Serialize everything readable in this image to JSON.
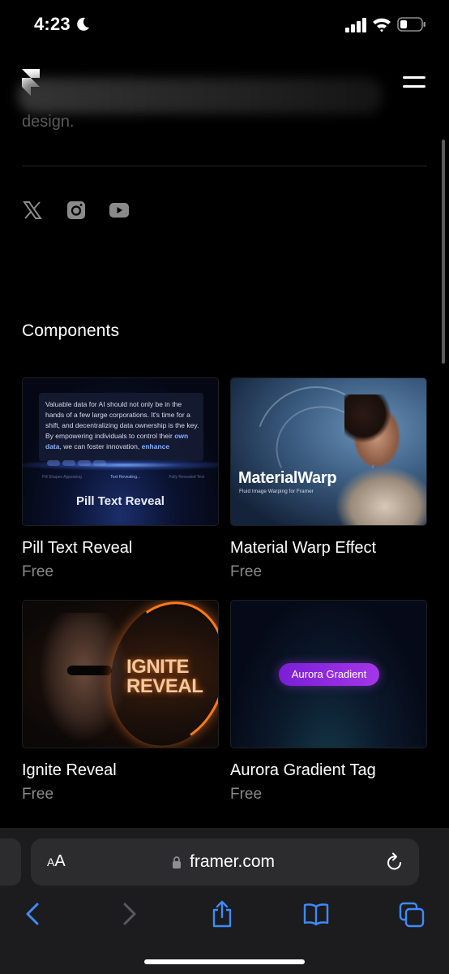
{
  "status_bar": {
    "time": "4:23"
  },
  "site": {
    "footer_tagline_end": "design."
  },
  "social": [
    "x-icon",
    "instagram-icon",
    "youtube-icon"
  ],
  "components": {
    "section_title": "Components",
    "cards": [
      {
        "title": "Pill Text Reveal",
        "price": "Free",
        "thumb": {
          "paragraph_start": "Valuable data for AI should not only be in the hands of a few large corporations. It's time for a shift, and decentralizing data ownership is the key. By empowering individuals to control their ",
          "highlight_1": "own data",
          "paragraph_mid": ", we can foster innovation, ",
          "highlight_2": "enhance",
          "step_1": "Pill Shapes Appearing",
          "step_2": "Text Revealing...",
          "step_3": "Fully Revealed Text",
          "caption": "Pill Text Reveal"
        }
      },
      {
        "title": "Material Warp Effect",
        "price": "Free",
        "thumb": {
          "caption": "MaterialWarp",
          "subcaption": "Fluid Image Warping for Framer"
        }
      },
      {
        "title": "Ignite Reveal",
        "price": "Free",
        "thumb": {
          "line1": "IGNITE",
          "line2": "REVEAL"
        }
      },
      {
        "title": "Aurora Gradient Tag",
        "price": "Free",
        "thumb": {
          "tag": "Aurora Gradient"
        }
      }
    ]
  },
  "browser": {
    "text_size_small": "A",
    "text_size_large": "A",
    "url": "framer.com",
    "toolbar": [
      "back-icon",
      "forward-icon",
      "share-icon",
      "bookmarks-icon",
      "tabs-icon"
    ]
  },
  "colors": {
    "background": "#000000",
    "muted_text": "#8a8a8a",
    "browser_chrome": "#1c1c1e",
    "address_bar": "#2c2c2e",
    "toolbar_blue": "#3e8bff",
    "aurora_tag": "#9a30e0"
  }
}
